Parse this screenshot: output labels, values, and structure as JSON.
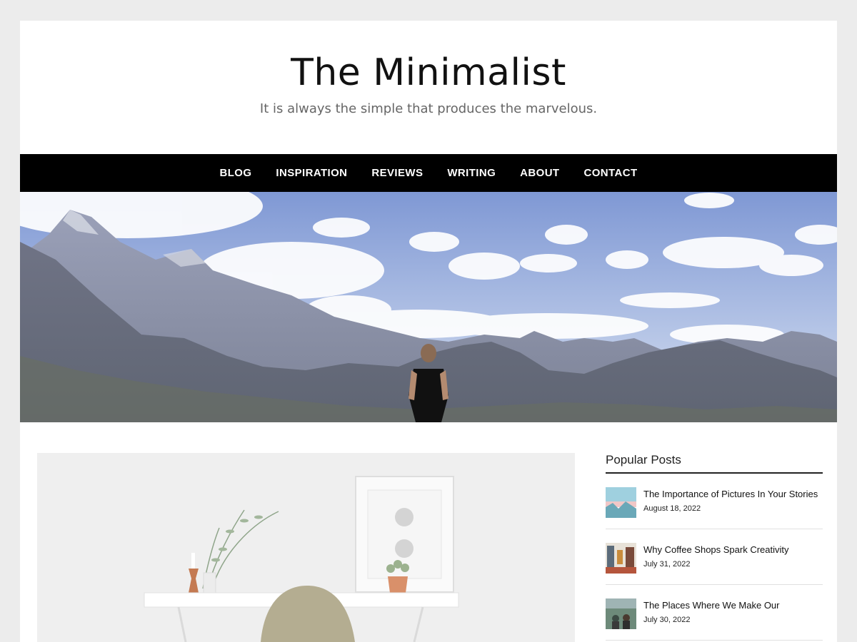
{
  "site": {
    "title": "The Minimalist",
    "tagline": "It is always the simple that produces the marvelous."
  },
  "nav": {
    "items": [
      {
        "label": "BLOG"
      },
      {
        "label": "INSPIRATION"
      },
      {
        "label": "REVIEWS"
      },
      {
        "label": "WRITING"
      },
      {
        "label": "ABOUT"
      },
      {
        "label": "CONTACT"
      }
    ]
  },
  "sidebar": {
    "widget_title": "Popular Posts",
    "posts": [
      {
        "title": "The Importance of Pictures In Your Stories",
        "date": "August 18, 2022"
      },
      {
        "title": "Why Coffee Shops Spark Creativity",
        "date": "July 31, 2022"
      },
      {
        "title": "The Places Where We Make Our",
        "date": "July 30, 2022"
      }
    ]
  },
  "colors": {
    "background": "#ececec",
    "nav_bar": "#000000",
    "text": "#111111"
  }
}
